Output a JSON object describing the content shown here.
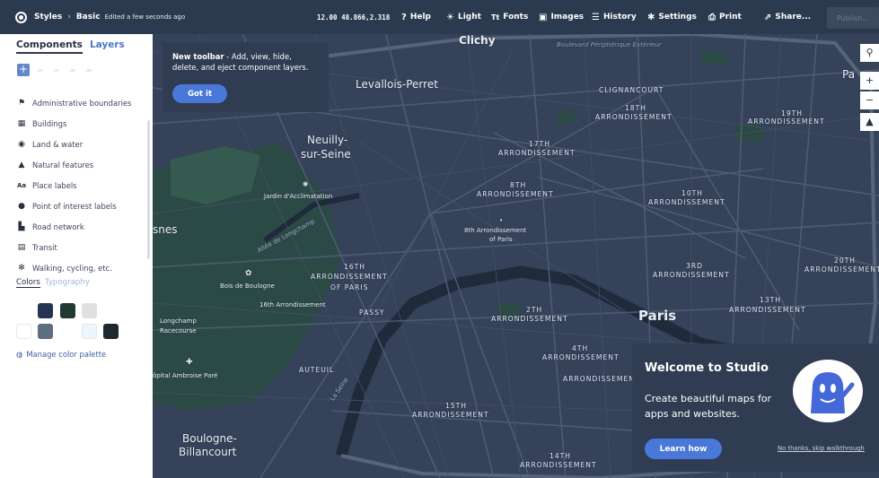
{
  "topbar": {
    "styles_label": "Styles",
    "style_name": "Basic",
    "edited": "Edited a few seconds ago",
    "coords": "12.00 48.866,2.318",
    "items": [
      {
        "label": "Help",
        "icon": "help-circle-icon",
        "glyph": "❓"
      },
      {
        "label": "Light",
        "icon": "sun-icon",
        "glyph": "☀"
      },
      {
        "label": "Fonts",
        "icon": "fonts-icon",
        "glyph": "Tt"
      },
      {
        "label": "Images",
        "icon": "image-icon",
        "glyph": "▣"
      },
      {
        "label": "History",
        "icon": "history-icon",
        "glyph": "☰"
      },
      {
        "label": "Settings",
        "icon": "gear-icon",
        "glyph": "✱"
      },
      {
        "label": "Print",
        "icon": "print-icon",
        "glyph": "⎙"
      },
      {
        "label": "Share...",
        "icon": "share-icon",
        "glyph": "⇗"
      }
    ],
    "publish": "Publish..."
  },
  "sidebar": {
    "tabs": [
      "Components",
      "Layers"
    ],
    "layers": [
      {
        "label": "Administrative boundaries",
        "icon": "flag-icon",
        "glyph": "⚑"
      },
      {
        "label": "Buildings",
        "icon": "building-icon",
        "glyph": "▦"
      },
      {
        "label": "Land & water",
        "icon": "globe-icon",
        "glyph": "◉"
      },
      {
        "label": "Natural features",
        "icon": "mountain-icon",
        "glyph": "▲"
      },
      {
        "label": "Place labels",
        "icon": "place-label-icon",
        "glyph": "Ꜳ"
      },
      {
        "label": "Point of interest labels",
        "icon": "pin-icon",
        "glyph": "●"
      },
      {
        "label": "Road network",
        "icon": "road-icon",
        "glyph": "⛽"
      },
      {
        "label": "Transit",
        "icon": "transit-icon",
        "glyph": "▤"
      },
      {
        "label": "Walking, cycling, etc.",
        "icon": "walking-icon",
        "glyph": "🚶"
      }
    ],
    "color_tabs": [
      "Colors",
      "Typography"
    ],
    "swatches": [
      "#273354",
      "#213a33",
      "#dfe0e0",
      "#ffffff",
      "#5f6d80",
      "#ffffff",
      "#eef6fb",
      "#1c2a30"
    ],
    "manage_palette": "Manage color palette"
  },
  "tooltip": {
    "title": "New toolbar",
    "text": " - Add, view, hide, delete, and eject component layers.",
    "button": "Got it"
  },
  "welcome": {
    "title": "Welcome to Studio",
    "text": "Create beautiful maps for apps and websites.",
    "learn": "Learn how",
    "skip": "No thanks, skip walkthrough"
  },
  "map": {
    "labels": {
      "clichy": "Clichy",
      "periph": "Boulevard Périphérique Extérieur",
      "levallois": "Levallois-Perret",
      "neuilly1": "Neuilly-",
      "neuilly2": "sur-Seine",
      "clignancourt": "CLIGNANCOURT",
      "a18": "18TH",
      "a18b": "ARRONDISSEMENT",
      "a17": "17TH",
      "a17b": "ARRONDISSEMENT",
      "a19": "19TH",
      "a19b": "ARRONDISSEMENT",
      "a8": "8TH",
      "a8b": "ARRONDISSEMENT",
      "a10": "10TH",
      "a10b": "ARRONDISSEMENT",
      "jardin": "Jardin d'Acclimatation",
      "pont": "Allée de Longchamp",
      "a8paris1": "8th Arrondissement",
      "a8paris2": "of Paris",
      "snes": "snes",
      "a16": "16TH",
      "a16b": "ARRONDISSEMENT",
      "a16c": "OF PARIS",
      "bois": "Bois de Boulogne",
      "a16th": "16th Arrondissement",
      "passy": "PASSY",
      "a2": "2TH",
      "a2b": "ARRONDISSEMENT",
      "a3": "3RD",
      "a3b": "ARRONDISSEMENT",
      "a20": "20TH",
      "a20b": "ARRONDISSEMENT",
      "a13": "13TH",
      "a13b": "ARRONDISSEMENT",
      "paris": "Paris",
      "longchamp1": "Longchamp",
      "longchamp2": "Racecourse",
      "auteuil": "AUTEUIL",
      "hopital": "ôpital Ambroise Paré",
      "a4": "4TH",
      "a4b": "ARRONDISSEMENT",
      "a15": "15TH",
      "a15b": "ARRONDISSEMENT",
      "boulogne1": "Boulogne-",
      "boulogne2": "Billancourt",
      "a14": "14TH",
      "a14b": "ARRONDISSEMENT",
      "seine": "La Seine",
      "ardm": "ARRONDISSEMENT",
      "pa": "Pa"
    },
    "controls": [
      "⚲",
      "+",
      "−",
      "⮝"
    ]
  }
}
